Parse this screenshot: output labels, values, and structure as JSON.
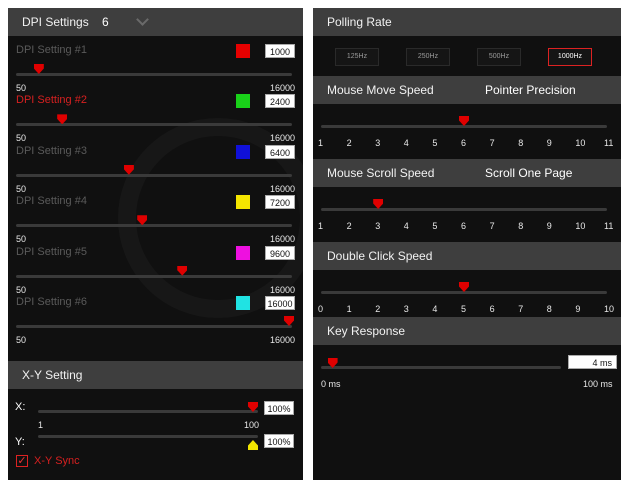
{
  "left": {
    "dpi_header": {
      "title": "DPI Settings",
      "count": "6"
    },
    "dpi_settings": [
      {
        "label": "DPI Setting #1",
        "color": "#e60000",
        "value": "1000",
        "min": "50",
        "max": "16000",
        "active": false
      },
      {
        "label": "DPI Setting #2",
        "color": "#19d119",
        "value": "2400",
        "min": "50",
        "max": "16000",
        "active": true
      },
      {
        "label": "DPI Setting #3",
        "color": "#1010d8",
        "value": "6400",
        "min": "50",
        "max": "16000",
        "active": false
      },
      {
        "label": "DPI Setting #4",
        "color": "#f5e600",
        "value": "7200",
        "min": "50",
        "max": "16000",
        "active": false
      },
      {
        "label": "DPI Setting #5",
        "color": "#ee10e0",
        "value": "9600",
        "min": "50",
        "max": "16000",
        "active": false
      },
      {
        "label": "DPI Setting #6",
        "color": "#20e3e3",
        "value": "16000",
        "min": "50",
        "max": "16000",
        "active": false
      }
    ],
    "xy": {
      "title": "X-Y Setting",
      "x_label": "X:",
      "x_value": "100%",
      "x_min": "1",
      "x_max": "100",
      "y_label": "Y:",
      "y_value": "100%",
      "sync_label": "X-Y Sync",
      "sync_checked": true
    }
  },
  "right": {
    "polling": {
      "title": "Polling Rate",
      "options": [
        "125Hz",
        "250Hz",
        "500Hz",
        "1000Hz"
      ],
      "selected": "1000Hz"
    },
    "move": {
      "title": "Mouse Move Speed",
      "subtitle": "Pointer Precision",
      "ticks": [
        "1",
        "2",
        "3",
        "4",
        "5",
        "6",
        "7",
        "8",
        "9",
        "10",
        "11"
      ],
      "value": 6
    },
    "scroll": {
      "title": "Mouse Scroll Speed",
      "subtitle": "Scroll One Page",
      "ticks": [
        "1",
        "2",
        "3",
        "4",
        "5",
        "6",
        "7",
        "8",
        "9",
        "10",
        "11"
      ],
      "value": 3
    },
    "dblclick": {
      "title": "Double Click Speed",
      "ticks": [
        "0",
        "1",
        "2",
        "3",
        "4",
        "5",
        "6",
        "7",
        "8",
        "9",
        "10"
      ],
      "value": 5
    },
    "key": {
      "title": "Key Response",
      "value": "4 ms",
      "min": "0 ms",
      "max": "100 ms",
      "fraction": 0.04
    }
  }
}
